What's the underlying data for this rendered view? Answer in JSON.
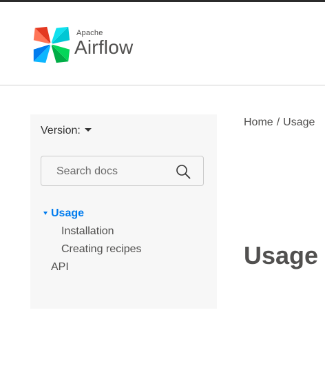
{
  "brand": {
    "small": "Apache",
    "big": "Airflow"
  },
  "sidebar": {
    "version_label": "Version:",
    "search": {
      "placeholder": "Search docs"
    },
    "items": [
      {
        "label": "Usage",
        "active": true
      },
      {
        "label": "Installation",
        "active": false
      },
      {
        "label": "Creating recipes",
        "active": false
      },
      {
        "label": "API",
        "active": false
      }
    ]
  },
  "breadcrumb": {
    "home": "Home",
    "separator": "/",
    "current": "Usage"
  },
  "main": {
    "title": "Usage"
  },
  "colors": {
    "accent": "#017cee",
    "text": "#51504f",
    "sidebar_bg": "#f7f7f7"
  },
  "icons": {
    "logo": "airflow-pinwheel-logo",
    "search": "search-icon",
    "version_caret": "caret-down-icon",
    "nav_expand": "triangle-down-icon"
  }
}
